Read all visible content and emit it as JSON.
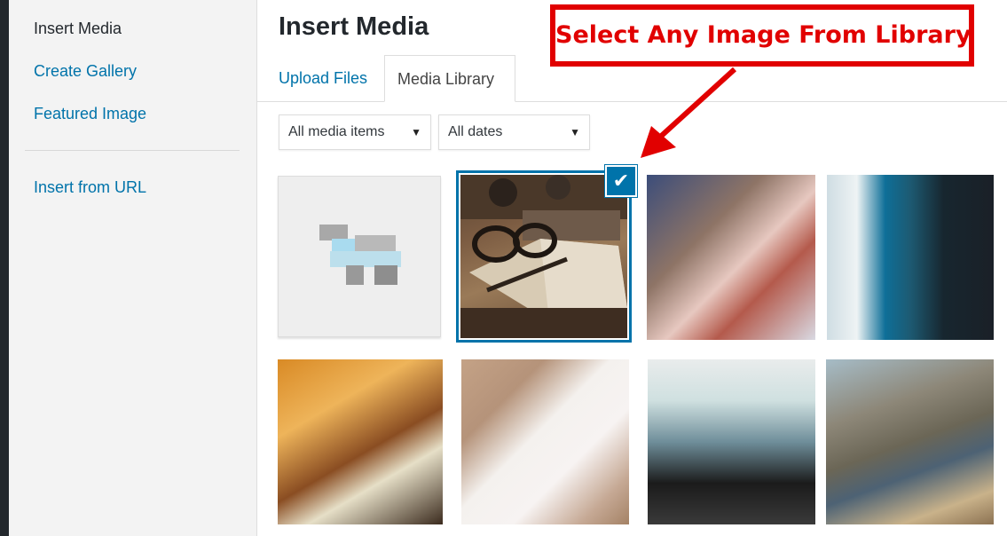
{
  "sidebar": {
    "items": [
      {
        "label": "Insert Media",
        "active": true
      },
      {
        "label": "Create Gallery",
        "active": false
      },
      {
        "label": "Featured Image",
        "active": false
      }
    ],
    "url_item": {
      "label": "Insert from URL"
    }
  },
  "frame": {
    "title": "Insert Media",
    "tabs": [
      {
        "label": "Upload Files",
        "active": false
      },
      {
        "label": "Media Library",
        "active": true
      }
    ]
  },
  "filters": {
    "type": {
      "selected": "All media items"
    },
    "date": {
      "selected": "All dates"
    }
  },
  "library": {
    "items": [
      {
        "kind": "placeholder",
        "icon": "document-icon",
        "selected": false
      },
      {
        "kind": "image",
        "description": "eyeglasses and open notebook on wooden desk",
        "selected": true
      },
      {
        "kind": "image",
        "description": "hands typing",
        "selected": false
      },
      {
        "kind": "image",
        "description": "person by window",
        "selected": false
      },
      {
        "kind": "image",
        "description": "warm-toned table scene",
        "selected": false
      },
      {
        "kind": "image",
        "description": "hands with white paper",
        "selected": false
      },
      {
        "kind": "image",
        "description": "dark landscape",
        "selected": false
      },
      {
        "kind": "image",
        "description": "person sitting outdoors",
        "selected": false
      }
    ]
  },
  "annotation": {
    "text": "Select Any Image From Library",
    "color": "#e10000"
  },
  "colors": {
    "accent": "#0073aa",
    "link": "#0073aa",
    "annotation": "#e10000"
  }
}
